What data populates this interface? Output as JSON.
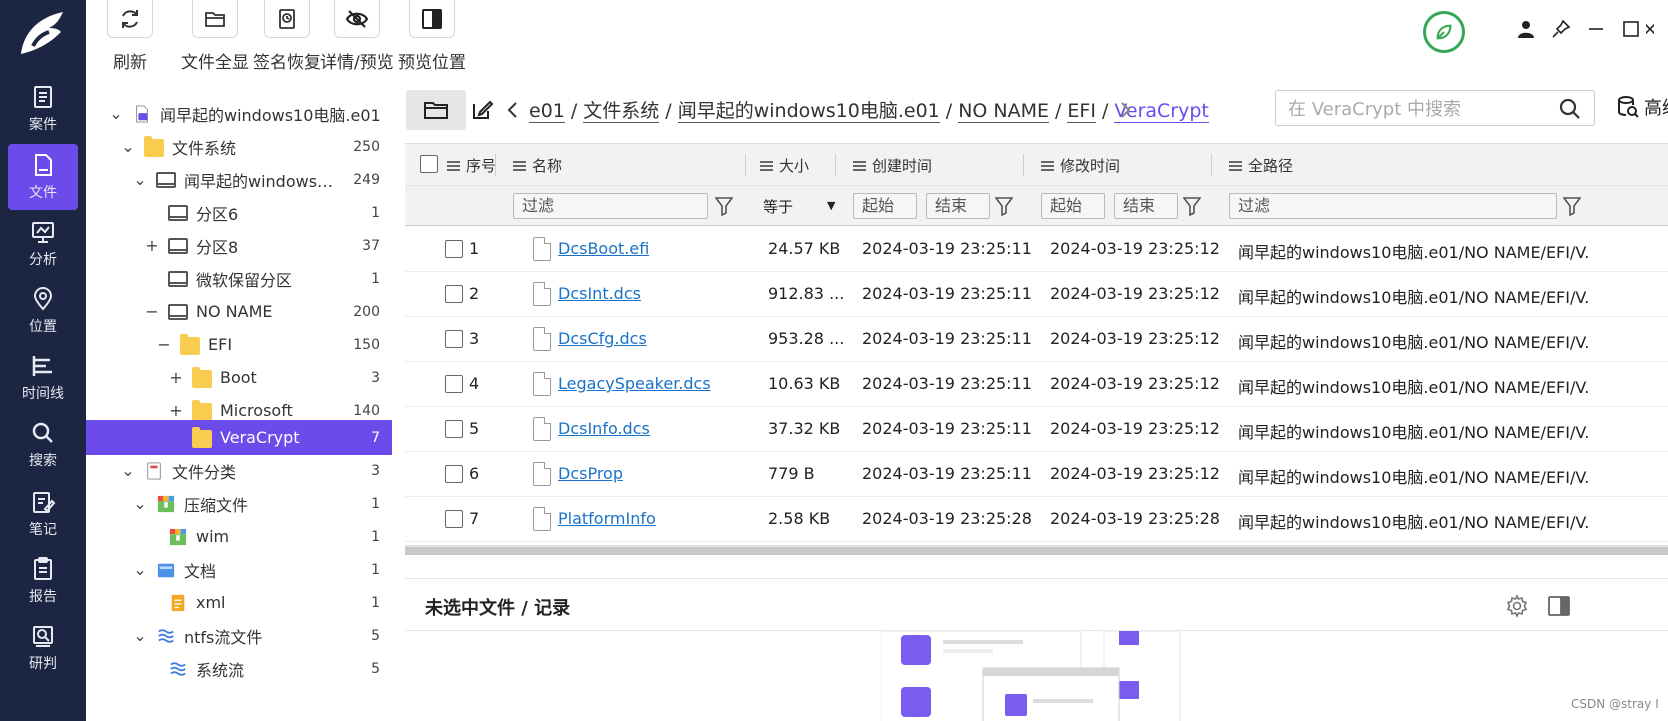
{
  "rail": {
    "items": [
      {
        "label": "案件",
        "icon": "case-icon"
      },
      {
        "label": "文件",
        "icon": "file-icon"
      },
      {
        "label": "分析",
        "icon": "analysis-icon"
      },
      {
        "label": "位置",
        "icon": "location-icon"
      },
      {
        "label": "时间线",
        "icon": "timeline-icon"
      },
      {
        "label": "搜索",
        "icon": "search-icon"
      },
      {
        "label": "笔记",
        "icon": "note-icon"
      },
      {
        "label": "报告",
        "icon": "report-icon"
      },
      {
        "label": "研判",
        "icon": "judge-icon"
      }
    ],
    "active": "文件"
  },
  "toolbar": {
    "refresh_label": "刷新",
    "show_all_label": "文件全显",
    "signature_label": "签名恢复",
    "detail_label": "详情/预览",
    "preview_pos_label": "预览位置"
  },
  "tree": {
    "root_label": "闻早起的windows10电脑.e01",
    "filesystem_label": "文件系统",
    "filesystem_count": "250",
    "disk_label": "闻早起的windows10...",
    "disk_count": "249",
    "p6_label": "分区6",
    "p6_count": "1",
    "p8_label": "分区8",
    "p8_count": "37",
    "ms_reserved_label": "微软保留分区",
    "ms_reserved_count": "1",
    "noname_label": "NO NAME",
    "noname_count": "200",
    "efi_label": "EFI",
    "efi_count": "150",
    "boot_label": "Boot",
    "boot_count": "3",
    "microsoft_label": "Microsoft",
    "microsoft_count": "140",
    "veracrypt_label": "VeraCrypt",
    "veracrypt_count": "7",
    "category_label": "文件分类",
    "category_count": "3",
    "zip_label": "压缩文件",
    "zip_count": "1",
    "wim_label": "wim",
    "wim_count": "1",
    "doc_label": "文档",
    "doc_count": "1",
    "xml_label": "xml",
    "xml_count": "1",
    "ntfs_label": "ntfs流文件",
    "ntfs_count": "5",
    "stream_label": "系统流",
    "stream_count": "5"
  },
  "pathbar": {
    "crumb_1": "e01",
    "crumb_2": "文件系统",
    "crumb_3": "闻早起的windows10电脑.e01",
    "crumb_4": "NO NAME",
    "crumb_5": "EFI",
    "crumb_6": "VeraCrypt",
    "search_placeholder": "在 VeraCrypt 中搜索",
    "advanced_label": "高级"
  },
  "grid": {
    "headers": {
      "index": "序号",
      "name": "名称",
      "size": "大小",
      "created": "创建时间",
      "modified": "修改时间",
      "path": "全路径"
    },
    "filters": {
      "name_placeholder": "过滤",
      "size_op": "等于",
      "created_start": "起始",
      "created_end": "结束",
      "modified_start": "起始",
      "modified_end": "结束",
      "path_placeholder": "过滤"
    },
    "rows": [
      {
        "idx": "1",
        "name": "DcsBoot.efi",
        "size": "24.57 KB",
        "created": "2024-03-19 23:25:11",
        "modified": "2024-03-19 23:25:12",
        "path": "闻早起的windows10电脑.e01/NO NAME/EFI/V..."
      },
      {
        "idx": "2",
        "name": "DcsInt.dcs",
        "size": "912.83 ...",
        "created": "2024-03-19 23:25:11",
        "modified": "2024-03-19 23:25:12",
        "path": "闻早起的windows10电脑.e01/NO NAME/EFI/V..."
      },
      {
        "idx": "3",
        "name": "DcsCfg.dcs",
        "size": "953.28 ...",
        "created": "2024-03-19 23:25:11",
        "modified": "2024-03-19 23:25:12",
        "path": "闻早起的windows10电脑.e01/NO NAME/EFI/V..."
      },
      {
        "idx": "4",
        "name": "LegacySpeaker.dcs",
        "size": "10.63 KB",
        "created": "2024-03-19 23:25:11",
        "modified": "2024-03-19 23:25:12",
        "path": "闻早起的windows10电脑.e01/NO NAME/EFI/V..."
      },
      {
        "idx": "5",
        "name": "DcsInfo.dcs",
        "size": "37.32 KB",
        "created": "2024-03-19 23:25:11",
        "modified": "2024-03-19 23:25:12",
        "path": "闻早起的windows10电脑.e01/NO NAME/EFI/V..."
      },
      {
        "idx": "6",
        "name": "DcsProp",
        "size": "779 B",
        "created": "2024-03-19 23:25:11",
        "modified": "2024-03-19 23:25:12",
        "path": "闻早起的windows10电脑.e01/NO NAME/EFI/V..."
      },
      {
        "idx": "7",
        "name": "PlatformInfo",
        "size": "2.58 KB",
        "created": "2024-03-19 23:25:28",
        "modified": "2024-03-19 23:25:28",
        "path": "闻早起的windows10电脑.e01/NO NAME/EFI/V..."
      }
    ]
  },
  "detail": {
    "title": "未选中文件 / 记录"
  },
  "watermark": "CSDN @stray I",
  "colors": {
    "rail_bg": "#1c2541",
    "accent": "#6b4bea",
    "link": "#1a73c8",
    "status_green": "#35a853",
    "folder": "#f8cd4f"
  }
}
